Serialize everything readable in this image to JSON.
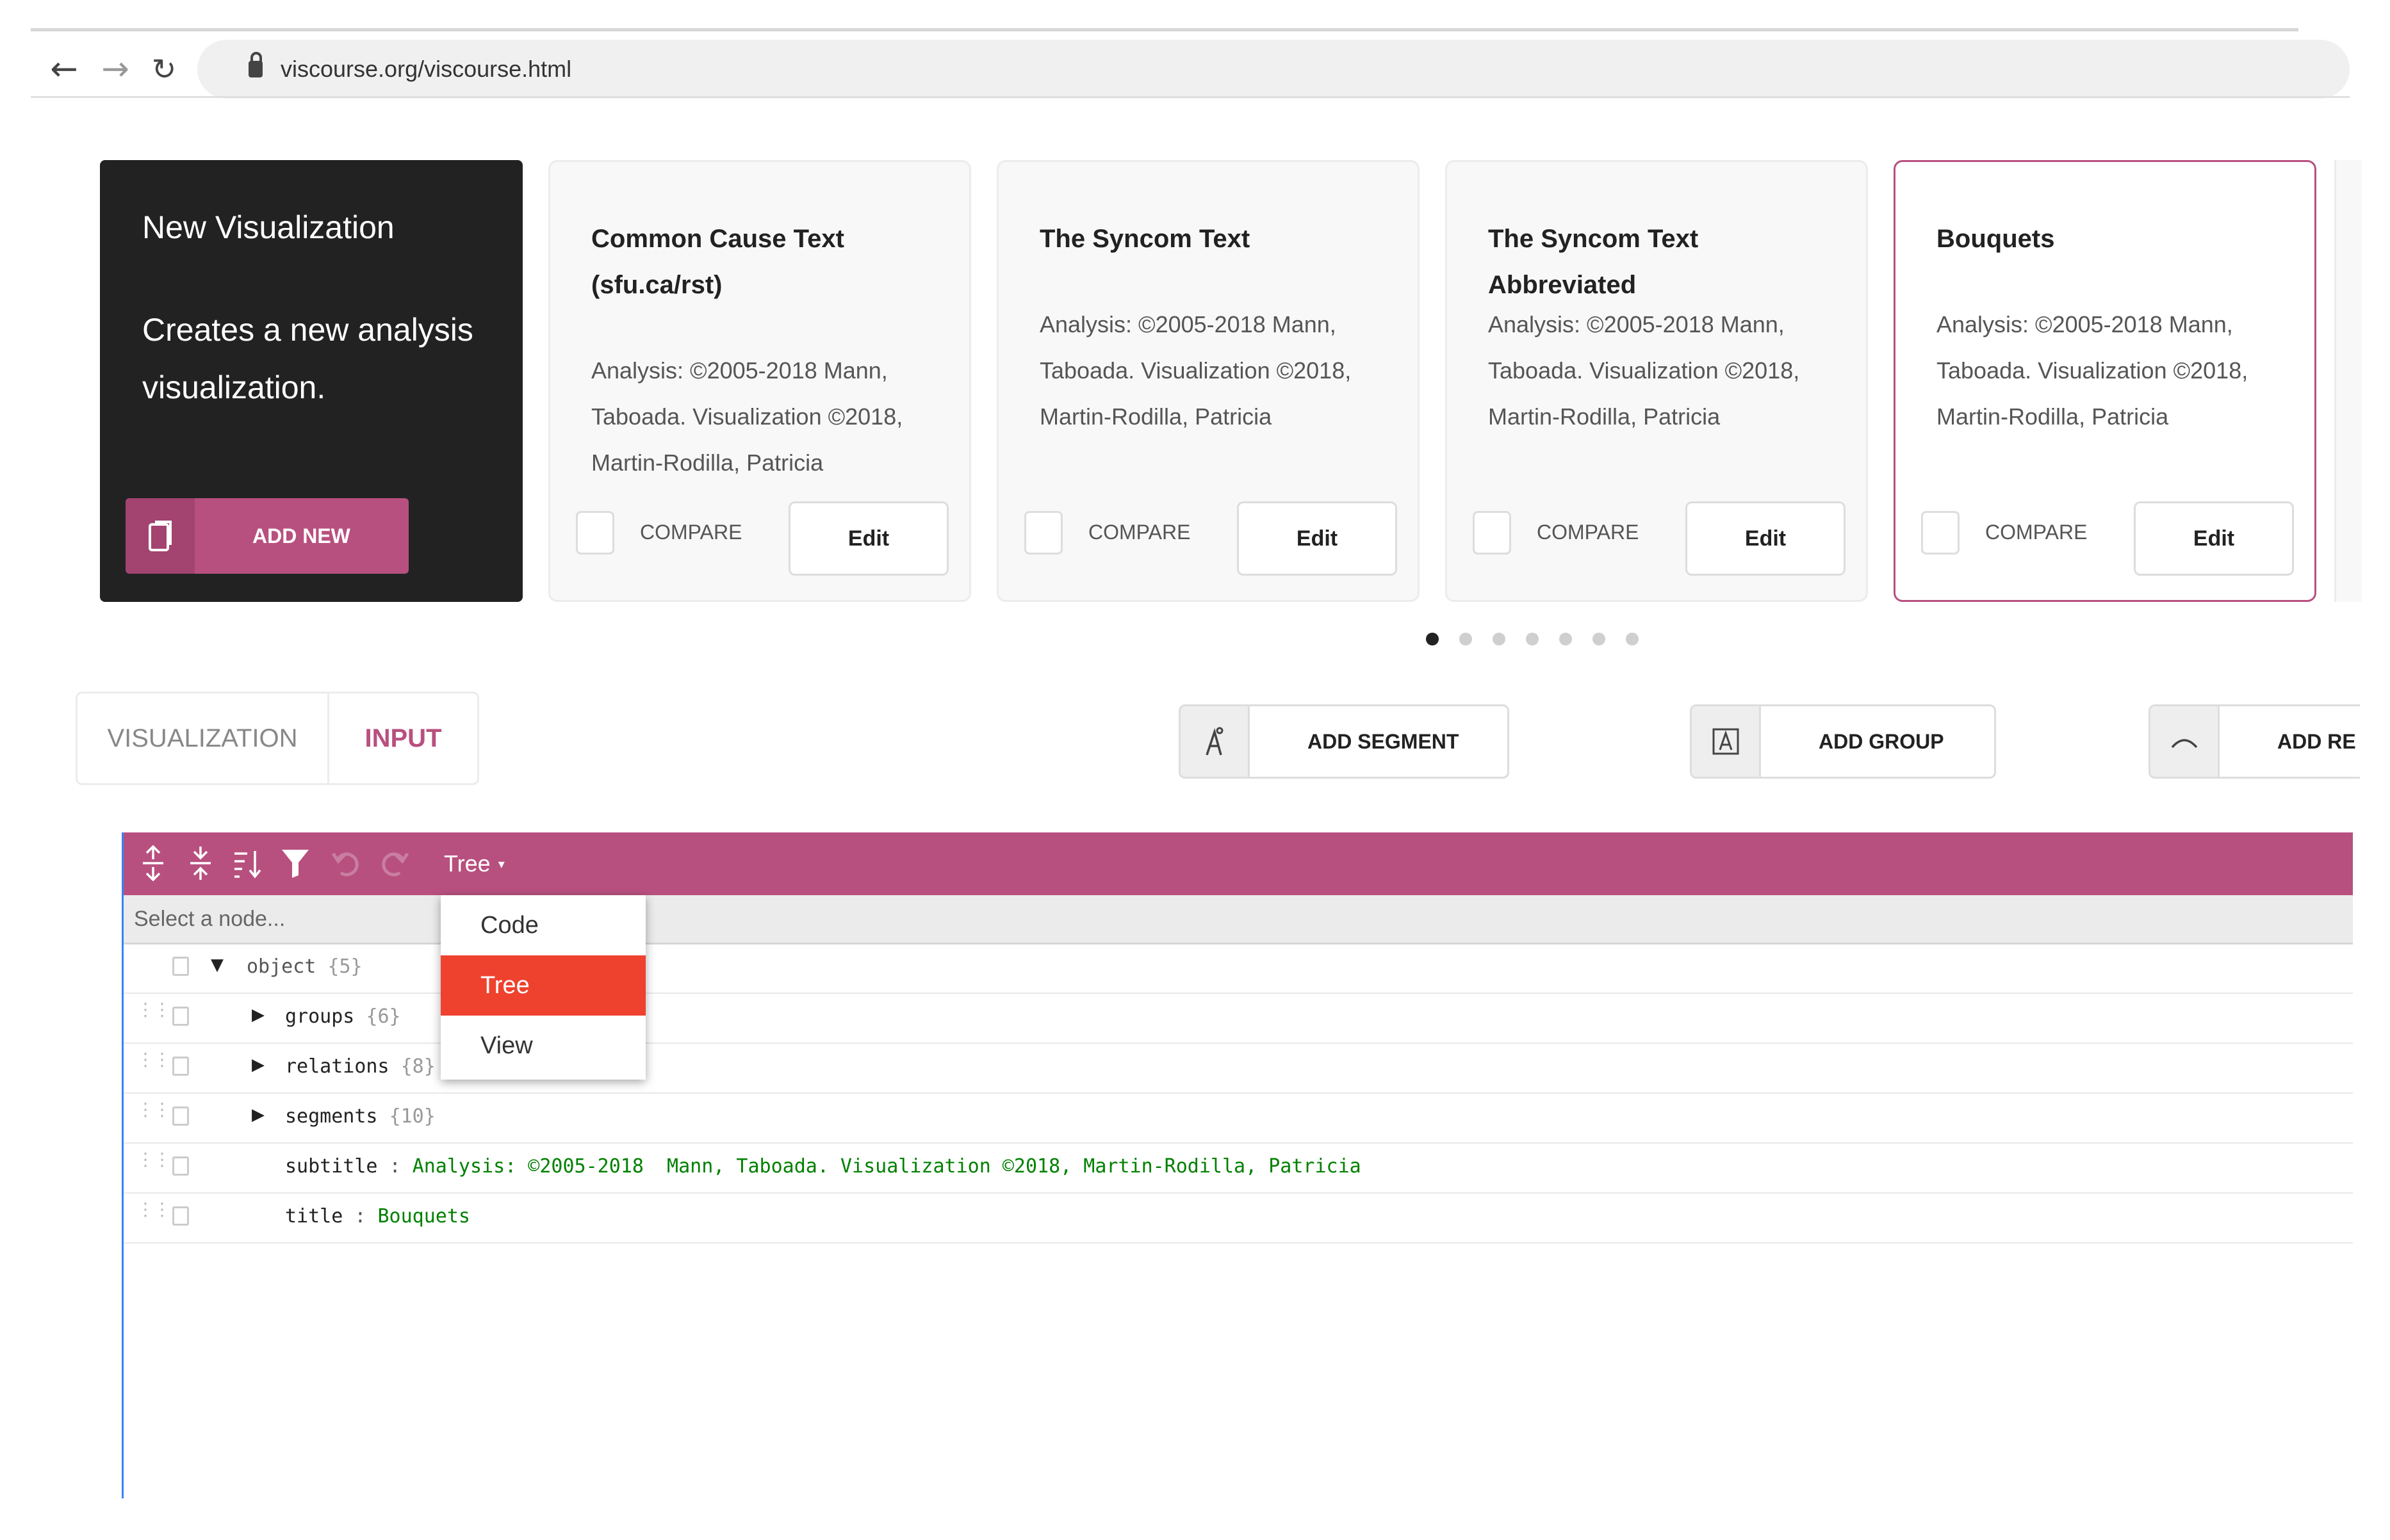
{
  "browser": {
    "url": "viscourse.org/viscourse.html",
    "icons": [
      "back-arrow-icon",
      "forward-arrow-icon",
      "reload-icon",
      "lock-icon"
    ]
  },
  "new_card": {
    "title": "New Visualization",
    "description": "Creates a new analysis visualization.",
    "button": "ADD NEW"
  },
  "cards": [
    {
      "title": "Common Cause Text (sfu.ca/rst)",
      "subtitle": "Analysis: ©2005-2018 Mann, Taboada. Visualization ©2018, Martin-Rodilla, Patricia",
      "compare": "COMPARE",
      "edit": "Edit"
    },
    {
      "title": "The Syncom Text",
      "subtitle": "Analysis: ©2005-2018 Mann, Taboada. Visualization ©2018, Martin-Rodilla, Patricia",
      "compare": "COMPARE",
      "edit": "Edit"
    },
    {
      "title": "The Syncom Text Abbreviated",
      "subtitle": "Analysis: ©2005-2018 Mann, Taboada. Visualization ©2018, Martin-Rodilla, Patricia",
      "compare": "COMPARE",
      "edit": "Edit"
    },
    {
      "title": "Bouquets",
      "subtitle": "Analysis: ©2005-2018 Mann, Taboada. Visualization ©2018, Martin-Rodilla, Patricia",
      "compare": "COMPARE",
      "edit": "Edit"
    }
  ],
  "carousel": {
    "pages": 7,
    "active": 1
  },
  "tabs": {
    "visualization": "VISUALIZATION",
    "input": "INPUT",
    "active": "INPUT"
  },
  "actions": {
    "add_segment": "ADD SEGMENT",
    "add_group": "ADD GROUP",
    "add_relation": "ADD RE"
  },
  "editor": {
    "mode": "Tree",
    "nav_placeholder": "Select a node...",
    "toolbar_icons": [
      "expand-all-icon",
      "collapse-all-icon",
      "sort-icon",
      "filter-icon",
      "undo-icon",
      "redo-icon"
    ],
    "mode_options": [
      "Code",
      "Tree",
      "View"
    ],
    "selected_mode": "Tree",
    "root": {
      "key": "object",
      "count": "{5}"
    },
    "nodes": [
      {
        "key": "groups",
        "count": "{6}"
      },
      {
        "key": "relations",
        "count": "{8}"
      },
      {
        "key": "segments",
        "count": "{10}"
      }
    ],
    "fields": [
      {
        "key": "subtitle",
        "value": "Analysis: ©2005-2018  Mann, Taboada. Visualization ©2018, Martin-Rodilla, Patricia"
      },
      {
        "key": "title",
        "value": "Bouquets"
      }
    ]
  },
  "colors": {
    "accent": "#b8507f",
    "selected": "#ee422e",
    "string": "#008000"
  }
}
